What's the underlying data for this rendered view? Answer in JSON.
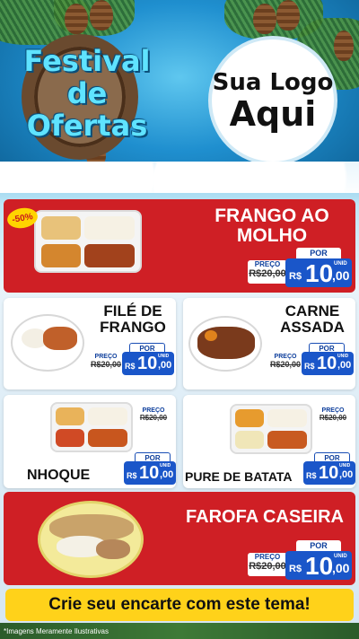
{
  "header": {
    "festival_line1": "Festival",
    "festival_line2": "de",
    "festival_line3": "Ofertas",
    "logo_line1": "Sua Logo",
    "logo_line2": "Aqui"
  },
  "badge": "-50%",
  "products": [
    {
      "name_line1": "FRANGO AO",
      "name_line2": "MOLHO",
      "price_label": "PREÇO",
      "old_price": "R$20,00",
      "por_label": "POR",
      "currency": "R$",
      "price_int": "10",
      "price_dec": ",00",
      "unit": "UNID"
    },
    {
      "name_line1": "FILÉ DE",
      "name_line2": "FRANGO",
      "price_label": "PREÇO",
      "old_price": "R$20,00",
      "por_label": "POR",
      "currency": "R$",
      "price_int": "10",
      "price_dec": ",00",
      "unit": "UNID"
    },
    {
      "name_line1": "CARNE",
      "name_line2": "ASSADA",
      "price_label": "PREÇO",
      "old_price": "R$20,00",
      "por_label": "POR",
      "currency": "R$",
      "price_int": "10",
      "price_dec": ",00",
      "unit": "UNID"
    },
    {
      "name_line1": "NHOQUE",
      "price_label": "PREÇO",
      "old_price": "R$20,00",
      "por_label": "POR",
      "currency": "R$",
      "price_int": "10",
      "price_dec": ",00",
      "unit": "UNID"
    },
    {
      "name_line1": "PURE DE BATATA",
      "price_label": "PREÇO",
      "old_price": "R$20,00",
      "por_label": "POR",
      "currency": "R$",
      "price_int": "10",
      "price_dec": ",00",
      "unit": "UNID"
    },
    {
      "name_line1": "FAROFA CASEIRA",
      "price_label": "PREÇO",
      "old_price": "R$20,00",
      "por_label": "POR",
      "currency": "R$",
      "price_int": "10",
      "price_dec": ",00",
      "unit": "UNID"
    }
  ],
  "cta_text": "Crie seu encarte com este tema!",
  "disclaimer": "*Imagens Meramente Ilustrativas",
  "colors": {
    "red_card": "#cf1f25",
    "price_blue": "#1a56c9",
    "cta_yellow": "#ffd21a"
  }
}
